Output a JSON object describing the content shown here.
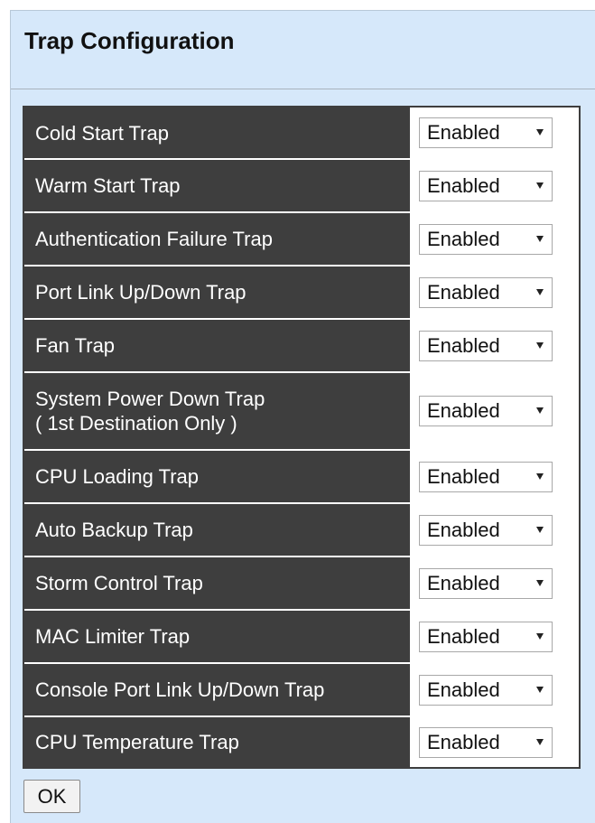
{
  "page": {
    "title": "Trap Configuration"
  },
  "rows": [
    {
      "label": "Cold Start Trap",
      "value": "Enabled"
    },
    {
      "label": "Warm Start Trap",
      "value": "Enabled"
    },
    {
      "label": "Authentication Failure Trap",
      "value": "Enabled"
    },
    {
      "label": "Port Link Up/Down Trap",
      "value": "Enabled"
    },
    {
      "label": "Fan Trap",
      "value": "Enabled"
    },
    {
      "label": "System Power Down Trap",
      "label2": "( 1st Destination Only )",
      "value": "Enabled"
    },
    {
      "label": "CPU Loading Trap",
      "value": "Enabled"
    },
    {
      "label": "Auto Backup Trap",
      "value": "Enabled"
    },
    {
      "label": "Storm Control Trap",
      "value": "Enabled"
    },
    {
      "label": "MAC Limiter Trap",
      "value": "Enabled"
    },
    {
      "label": "Console Port Link Up/Down Trap",
      "value": "Enabled"
    },
    {
      "label": "CPU Temperature Trap",
      "value": "Enabled"
    }
  ],
  "buttons": {
    "ok": "OK"
  }
}
